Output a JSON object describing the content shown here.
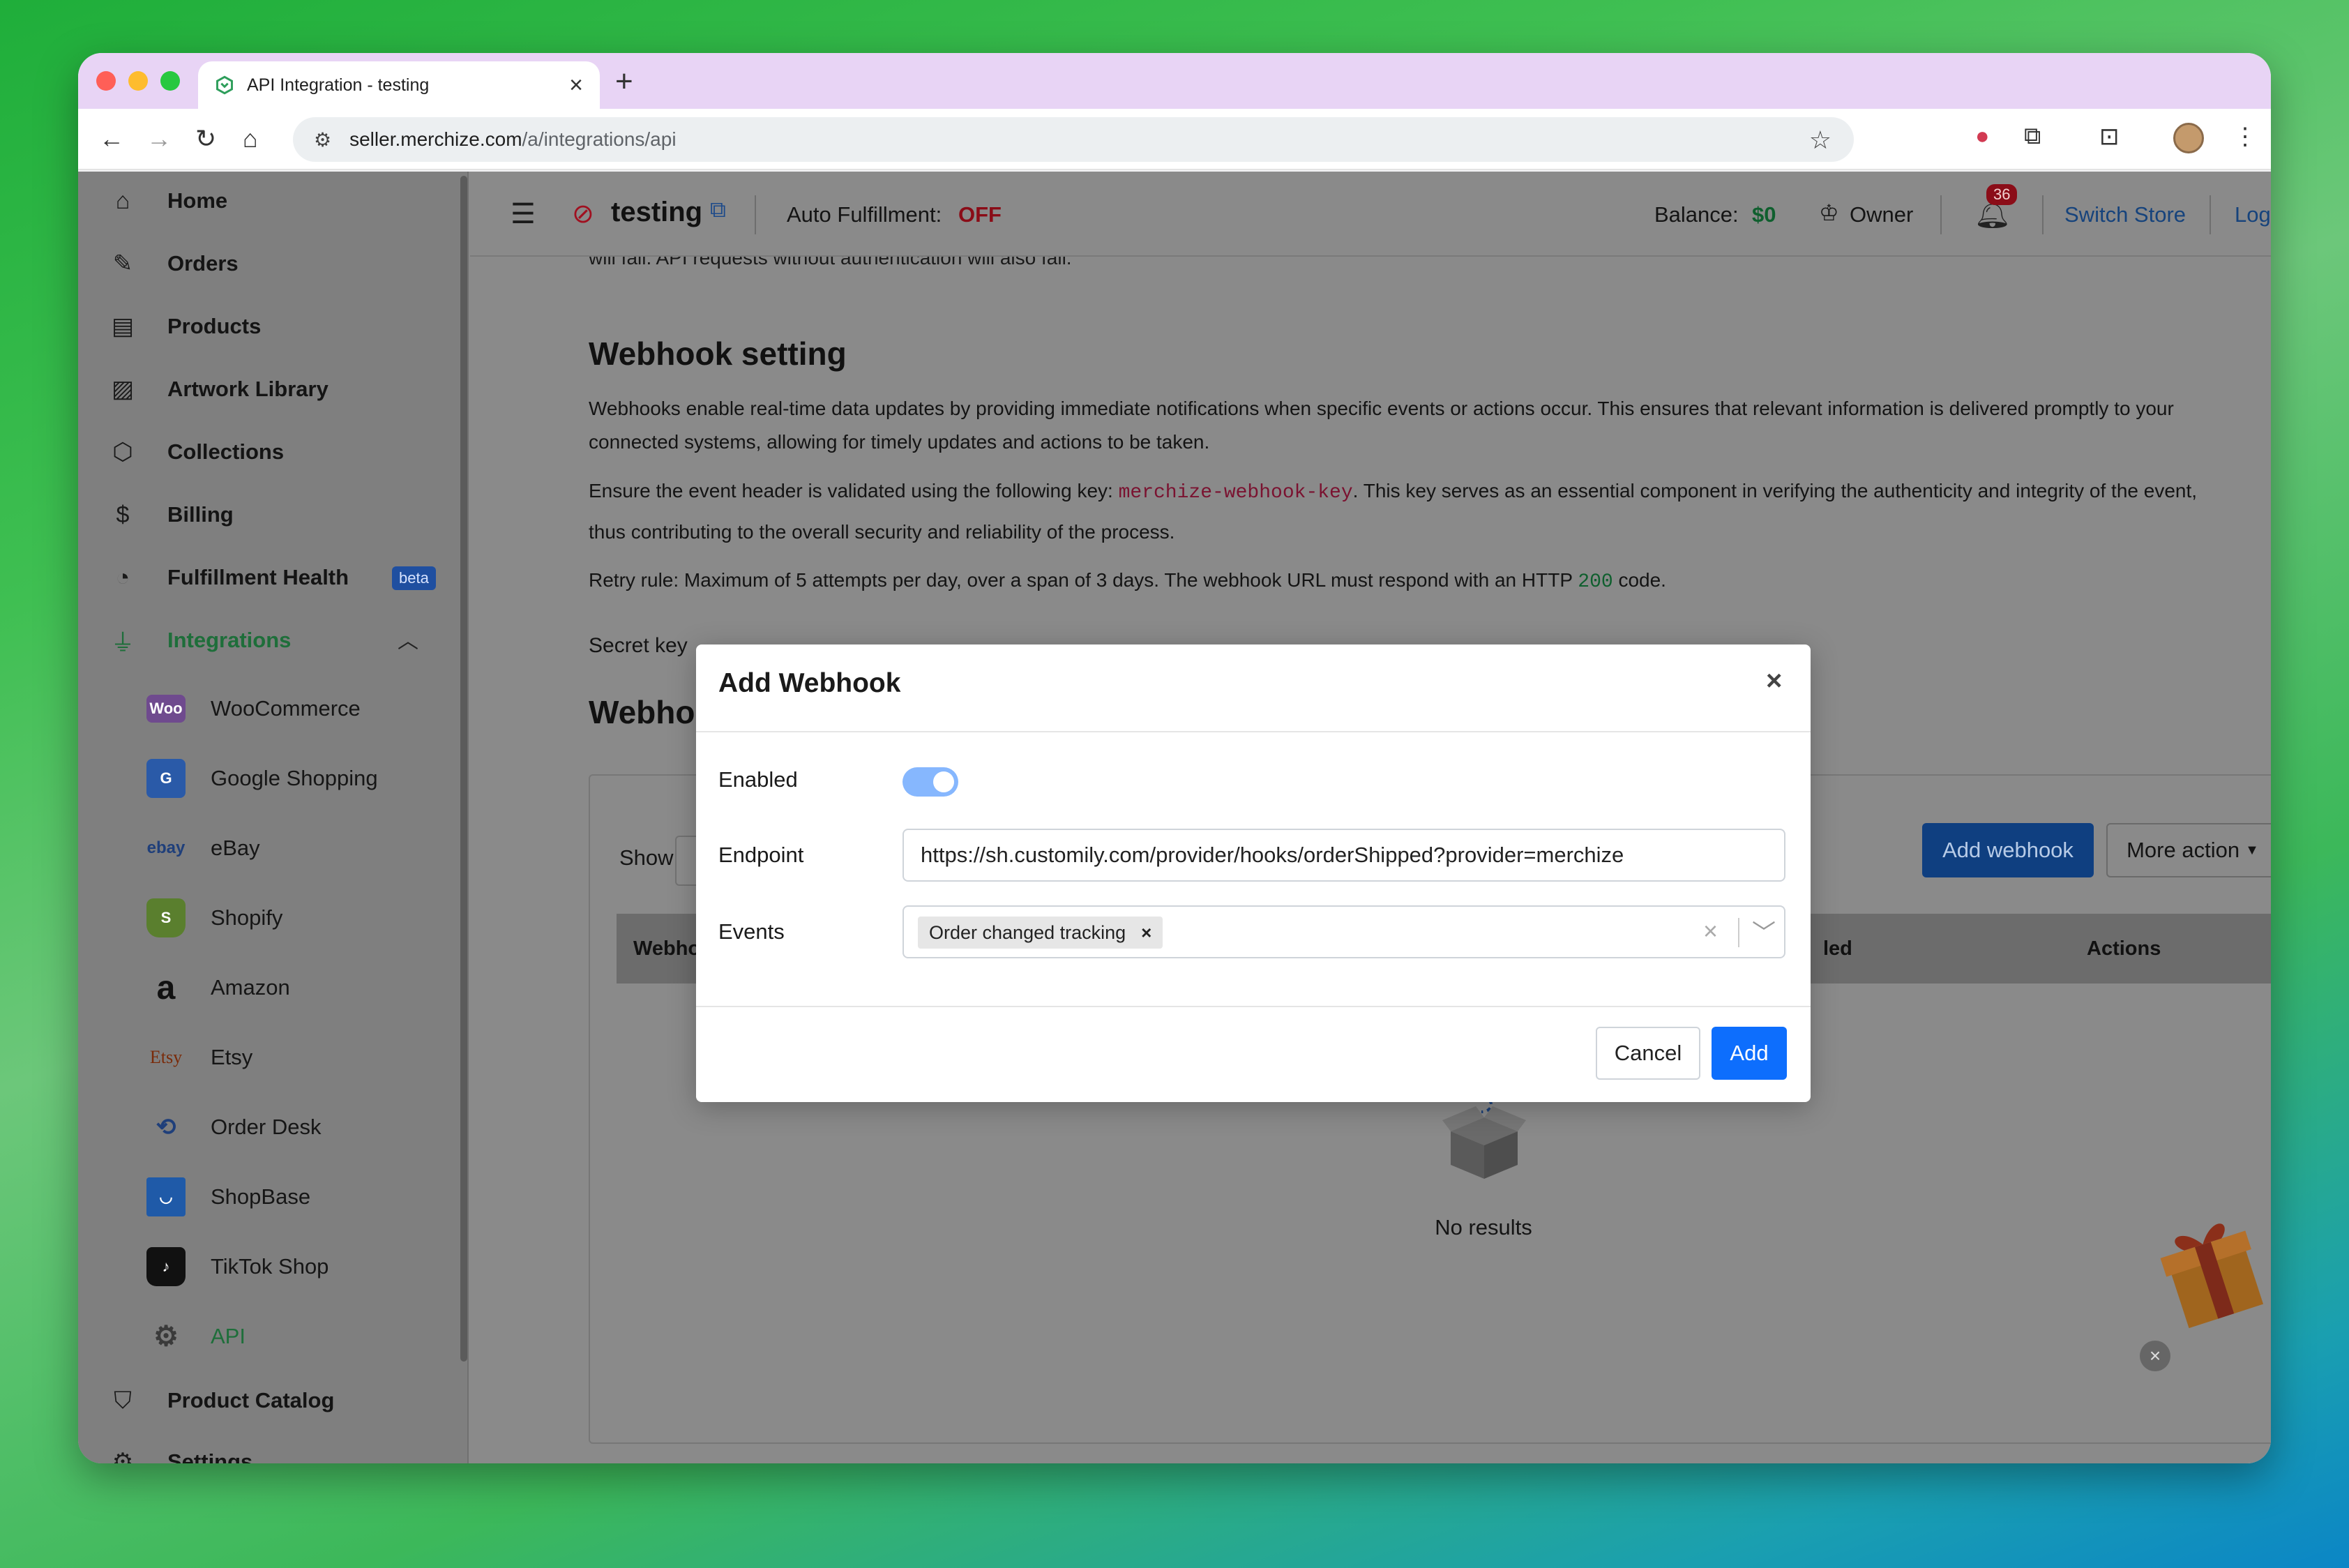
{
  "browser": {
    "tab_title": "API Integration - testing",
    "url_domain": "seller.merchize.com",
    "url_path": "/a/integrations/api"
  },
  "sidebar": {
    "items": [
      {
        "label": "Home",
        "icon": "home-icon"
      },
      {
        "label": "Orders",
        "icon": "edit-icon"
      },
      {
        "label": "Products",
        "icon": "archive-icon"
      },
      {
        "label": "Artwork Library",
        "icon": "image-icon"
      },
      {
        "label": "Collections",
        "icon": "box-icon"
      },
      {
        "label": "Billing",
        "icon": "dollar-icon"
      },
      {
        "label": "Fulfillment Health",
        "icon": "pie-icon",
        "badge": "beta"
      },
      {
        "label": "Integrations",
        "icon": "plug-icon"
      }
    ],
    "integrations": [
      {
        "label": "WooCommerce",
        "logo": "Woo",
        "color": "#6f4a8e"
      },
      {
        "label": "Google Shopping",
        "logo": "G",
        "color": "#2a5aa8"
      },
      {
        "label": "eBay",
        "logo": "ebay",
        "color": "#7f7f7f"
      },
      {
        "label": "Shopify",
        "logo": "S",
        "color": "#5a7f2e"
      },
      {
        "label": "Amazon",
        "logo": "a",
        "color": "#7f7f7f"
      },
      {
        "label": "Etsy",
        "logo": "Etsy",
        "color": "#7f7f7f"
      },
      {
        "label": "Order Desk",
        "logo": "OD",
        "color": "#7f7f7f"
      },
      {
        "label": "ShopBase",
        "logo": "SB",
        "color": "#1f5aa8"
      },
      {
        "label": "TikTok Shop",
        "logo": "TT",
        "color": "#111111"
      },
      {
        "label": "API",
        "logo": "API",
        "color": "#7f7f7f"
      }
    ],
    "bottom_items": [
      {
        "label": "Product Catalog",
        "icon": "shirt-icon"
      },
      {
        "label": "Settings",
        "icon": "gear-icon"
      }
    ]
  },
  "header": {
    "store_name": "testing",
    "auto_fulfillment_label": "Auto Fulfillment:",
    "auto_fulfillment_value": "OFF",
    "balance_label": "Balance:",
    "balance_value": "$0",
    "role": "Owner",
    "notification_count": "36",
    "switch_store": "Switch Store",
    "logout": "Logout"
  },
  "content": {
    "cut_text": "will fail. API requests without authentication will also fail.",
    "webhook_title": "Webhook setting",
    "para1": "Webhooks enable real-time data updates by providing immediate notifications when specific events or actions occur. This ensures that relevant information is delivered promptly to your connected systems, allowing for timely updates and actions to be taken.",
    "para2_pre": "Ensure the event header is validated using the following key: ",
    "para2_key": "merchize-webhook-key",
    "para2_post": ". This key serves as an essential component in verifying the authenticity and integrity of the event, thus contributing to the overall security and reliability of the process.",
    "retry_pre": "Retry rule: Maximum of 5 attempts per day, over a span of 3 days. The webhook URL must respond with an HTTP ",
    "retry_code": "200",
    "retry_post": " code.",
    "secret_key_label": "Secret key",
    "webhooks_title": "Webho",
    "show_label": "Show",
    "add_webhook": "Add webhook",
    "more_action": "More action",
    "col_webhook": "Webho",
    "col_enabled": "led",
    "col_actions": "Actions",
    "no_results": "No results"
  },
  "modal": {
    "title": "Add Webhook",
    "enabled_label": "Enabled",
    "enabled_value": true,
    "endpoint_label": "Endpoint",
    "endpoint_value": "https://sh.customily.com/provider/hooks/orderShipped?provider=merchize",
    "events_label": "Events",
    "event_chip": "Order changed tracking",
    "cancel": "Cancel",
    "add": "Add"
  }
}
